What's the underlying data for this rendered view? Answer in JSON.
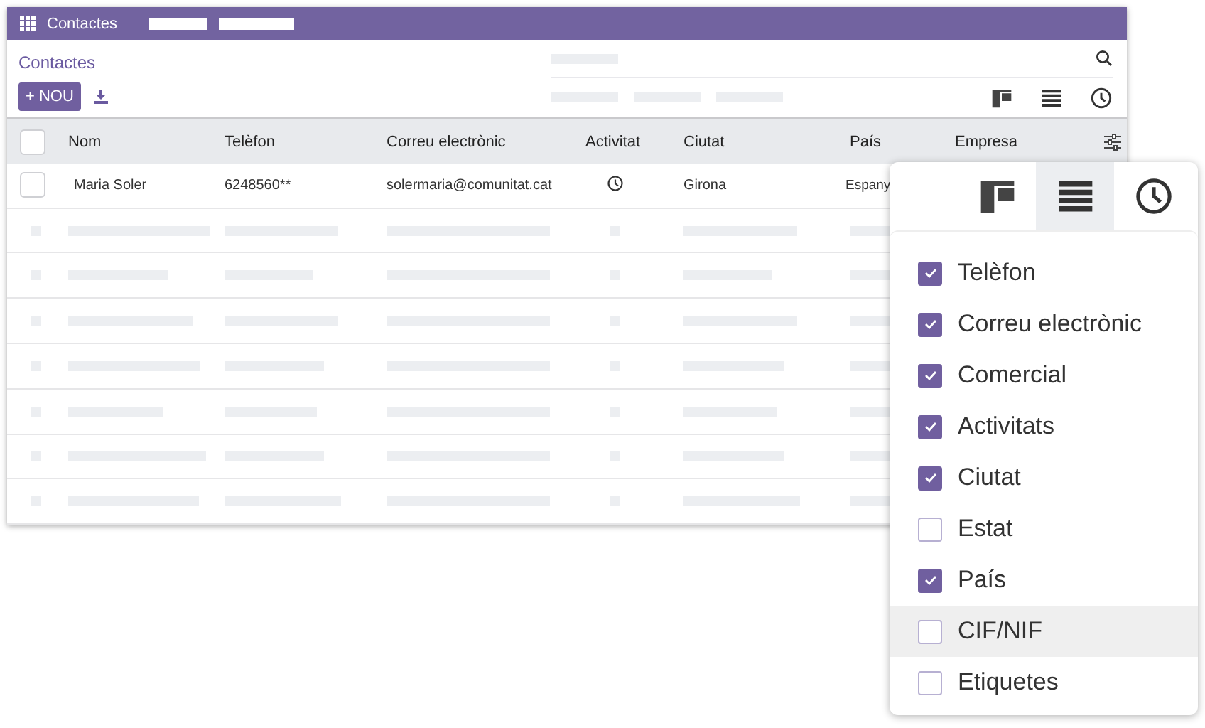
{
  "top_bar": {
    "title": "Contactes"
  },
  "page": {
    "title": "Contactes",
    "new_button": "+ NOU"
  },
  "table": {
    "all_selected": false,
    "columns": [
      "Nom",
      "Telèfon",
      "Correu electrònic",
      "Activitat",
      "Ciutat",
      "País",
      "Empresa"
    ],
    "rows": [
      {
        "selected": false,
        "name": "Maria Soler",
        "phone": "6248560**",
        "email": "solermaria@comunitat.cat",
        "city": "Girona",
        "country": "Espany"
      }
    ]
  },
  "column_menu": {
    "views": [
      {
        "kind": "board",
        "selected": false
      },
      {
        "kind": "list",
        "selected": true
      },
      {
        "kind": "history",
        "selected": false
      }
    ],
    "items": [
      {
        "label": "Telèfon",
        "checked": true,
        "highlighted": false
      },
      {
        "label": "Correu electrònic",
        "checked": true,
        "highlighted": false
      },
      {
        "label": "Comercial",
        "checked": true,
        "highlighted": false
      },
      {
        "label": "Activitats",
        "checked": true,
        "highlighted": false
      },
      {
        "label": "Ciutat",
        "checked": true,
        "highlighted": false
      },
      {
        "label": "Estat",
        "checked": false,
        "highlighted": false
      },
      {
        "label": "País",
        "checked": true,
        "highlighted": false
      },
      {
        "label": "CIF/NIF",
        "checked": false,
        "highlighted": true
      },
      {
        "label": "Etiquetes",
        "checked": false,
        "highlighted": false
      }
    ]
  }
}
